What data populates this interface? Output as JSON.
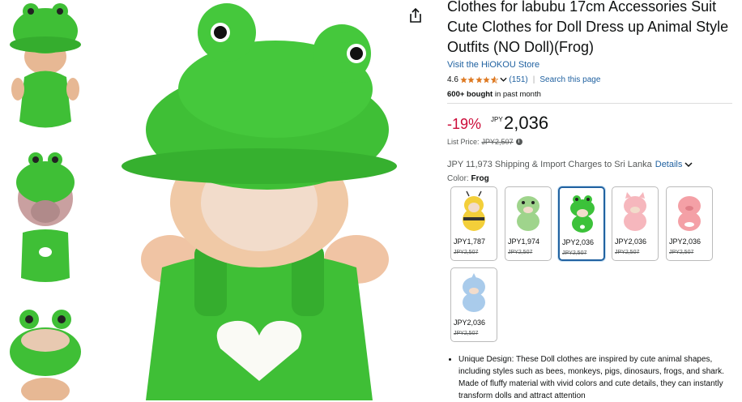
{
  "product": {
    "title": "Clothes for labubu 17cm Accessories Suit Cute Clothes for Doll Dress up Animal Style Outfits (NO Doll)(Frog)",
    "store_link": "Visit the HiOKOU Store",
    "rating_value": "4.6",
    "rating_count": "(151)",
    "search_link": "Search this page",
    "bought_bold": "600+ bought",
    "bought_rest": " in past month"
  },
  "price": {
    "discount": "-19%",
    "currency": "JPY",
    "amount": "2,036",
    "list_label": "List Price:",
    "list_value": "JPY2,507"
  },
  "shipping": {
    "text": "JPY 11,973 Shipping & Import Charges to Sri Lanka",
    "details_link": "Details"
  },
  "color": {
    "label": "Color:",
    "value": "Frog"
  },
  "swatches": [
    {
      "price": "JPY1,787",
      "list": "JPY2,507",
      "variant": "bee",
      "selected": false
    },
    {
      "price": "JPY1,974",
      "list": "JPY2,507",
      "variant": "dino",
      "selected": false
    },
    {
      "price": "JPY2,036",
      "list": "JPY2,507",
      "variant": "frog",
      "selected": true
    },
    {
      "price": "JPY2,036",
      "list": "JPY2,507",
      "variant": "pig",
      "selected": false
    },
    {
      "price": "JPY2,036",
      "list": "JPY2,507",
      "variant": "pig-pink",
      "selected": false
    },
    {
      "price": "JPY2,036",
      "list": "JPY2,507",
      "variant": "shark",
      "selected": false
    }
  ],
  "bullets": [
    "Unique Design: These Doll clothes are inspired by cute animal shapes, including styles such as bees, monkeys, pigs, dinosaurs, frogs, and shark. Made of fluffy material with vivid colors and cute details, they can instantly transform dolls and attract attention"
  ],
  "icons": {
    "share": "share-icon",
    "star": "star-icon",
    "chevron": "chevron-down-icon",
    "info": "info-icon"
  },
  "colors": {
    "link": "#2162a1",
    "discount": "#cc0c39",
    "star": "#de7921",
    "frog_green": "#3cc23a",
    "selected_border": "#2162a1"
  }
}
